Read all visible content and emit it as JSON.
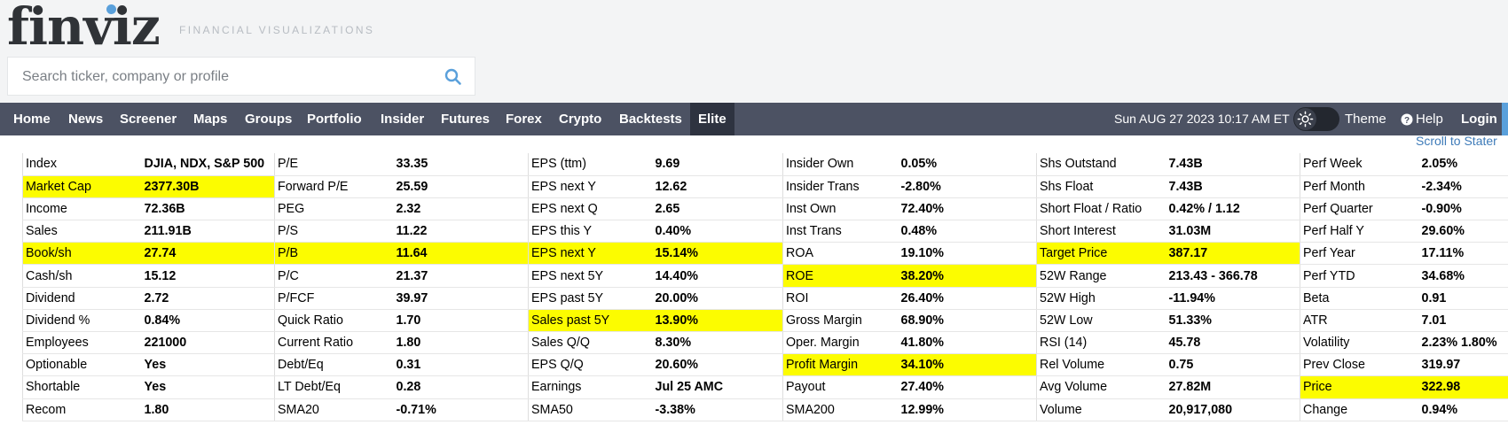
{
  "header": {
    "logo": "finviz",
    "tagline": "FINANCIAL VISUALIZATIONS",
    "search_placeholder": "Search ticker, company or profile"
  },
  "nav": {
    "items": [
      "Home",
      "News",
      "Screener",
      "Maps",
      "Groups",
      "Portfolio",
      "Insider",
      "Futures",
      "Forex",
      "Crypto",
      "Backtests",
      "Elite"
    ],
    "datetime": "Sun AUG 27 2023 10:17 AM ET",
    "theme": "Theme",
    "help": "Help",
    "login": "Login"
  },
  "scroll_link": "Scroll to Stater",
  "colors": {
    "positive": "#2e9a2e",
    "negative": "#a21e1e",
    "highlight": "#fcfc00",
    "nav_bg": "#4c5263"
  },
  "table": {
    "rows": [
      [
        [
          "Index",
          "DJIA, NDX, S&P 500"
        ],
        [
          "P/E",
          "33.35"
        ],
        [
          "EPS (ttm)",
          "9.69"
        ],
        [
          "Insider Own",
          "0.05%"
        ],
        [
          "Shs Outstand",
          "7.43B"
        ],
        [
          "Perf Week",
          "2.05%"
        ]
      ],
      [
        [
          "Market Cap",
          "2377.30B"
        ],
        [
          "Forward P/E",
          "25.59"
        ],
        [
          "EPS next Y",
          "12.62"
        ],
        [
          "Insider Trans",
          "-2.80%"
        ],
        [
          "Shs Float",
          "7.43B"
        ],
        [
          "Perf Month",
          "-2.34%"
        ]
      ],
      [
        [
          "Income",
          "72.36B"
        ],
        [
          "PEG",
          "2.32"
        ],
        [
          "EPS next Q",
          "2.65"
        ],
        [
          "Inst Own",
          "72.40%"
        ],
        [
          "Short Float / Ratio",
          "0.42% / 1.12"
        ],
        [
          "Perf Quarter",
          "-0.90%"
        ]
      ],
      [
        [
          "Sales",
          "211.91B"
        ],
        [
          "P/S",
          "11.22"
        ],
        [
          "EPS this Y",
          "0.40%"
        ],
        [
          "Inst Trans",
          "0.48%"
        ],
        [
          "Short Interest",
          "31.03M"
        ],
        [
          "Perf Half Y",
          "29.60%"
        ]
      ],
      [
        [
          "Book/sh",
          "27.74"
        ],
        [
          "P/B",
          "11.64"
        ],
        [
          "EPS next Y",
          "15.14%"
        ],
        [
          "ROA",
          "19.10%"
        ],
        [
          "Target Price",
          "387.17"
        ],
        [
          "Perf Year",
          "17.11%"
        ]
      ],
      [
        [
          "Cash/sh",
          "15.12"
        ],
        [
          "P/C",
          "21.37"
        ],
        [
          "EPS next 5Y",
          "14.40%"
        ],
        [
          "ROE",
          "38.20%"
        ],
        [
          "52W Range",
          "213.43 - 366.78"
        ],
        [
          "Perf YTD",
          "34.68%"
        ]
      ],
      [
        [
          "Dividend",
          "2.72"
        ],
        [
          "P/FCF",
          "39.97"
        ],
        [
          "EPS past 5Y",
          "20.00%"
        ],
        [
          "ROI",
          "26.40%"
        ],
        [
          "52W High",
          "-11.94%"
        ],
        [
          "Beta",
          "0.91"
        ]
      ],
      [
        [
          "Dividend %",
          "0.84%"
        ],
        [
          "Quick Ratio",
          "1.70"
        ],
        [
          "Sales past 5Y",
          "13.90%"
        ],
        [
          "Gross Margin",
          "68.90%"
        ],
        [
          "52W Low",
          "51.33%"
        ],
        [
          "ATR",
          "7.01"
        ]
      ],
      [
        [
          "Employees",
          "221000"
        ],
        [
          "Current Ratio",
          "1.80"
        ],
        [
          "Sales Q/Q",
          "8.30%"
        ],
        [
          "Oper. Margin",
          "41.80%"
        ],
        [
          "RSI (14)",
          "45.78"
        ],
        [
          "Volatility",
          "2.23% 1.80%"
        ]
      ],
      [
        [
          "Optionable",
          "Yes"
        ],
        [
          "Debt/Eq",
          "0.31"
        ],
        [
          "EPS Q/Q",
          "20.60%"
        ],
        [
          "Profit Margin",
          "34.10%"
        ],
        [
          "Rel Volume",
          "0.75"
        ],
        [
          "Prev Close",
          "319.97"
        ]
      ],
      [
        [
          "Shortable",
          "Yes"
        ],
        [
          "LT Debt/Eq",
          "0.28"
        ],
        [
          "Earnings",
          "Jul 25 AMC"
        ],
        [
          "Payout",
          "27.40%"
        ],
        [
          "Avg Volume",
          "27.82M"
        ],
        [
          "Price",
          "322.98"
        ]
      ],
      [
        [
          "Recom",
          "1.80"
        ],
        [
          "SMA20",
          "-0.71%"
        ],
        [
          "SMA50",
          "-3.38%"
        ],
        [
          "SMA200",
          "12.99%"
        ],
        [
          "Volume",
          "20,917,080"
        ],
        [
          "Change",
          "0.94%"
        ]
      ]
    ]
  }
}
